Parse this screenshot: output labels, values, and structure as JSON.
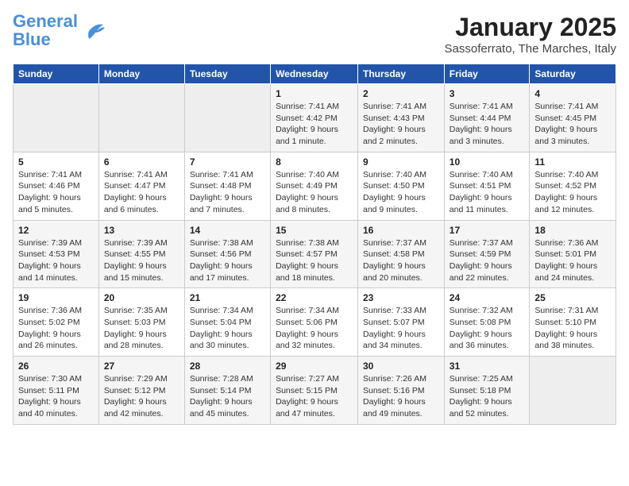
{
  "header": {
    "logo_line1": "General",
    "logo_line2": "Blue",
    "month": "January 2025",
    "location": "Sassoferrato, The Marches, Italy"
  },
  "weekdays": [
    "Sunday",
    "Monday",
    "Tuesday",
    "Wednesday",
    "Thursday",
    "Friday",
    "Saturday"
  ],
  "weeks": [
    [
      {
        "day": "",
        "info": ""
      },
      {
        "day": "",
        "info": ""
      },
      {
        "day": "",
        "info": ""
      },
      {
        "day": "1",
        "info": "Sunrise: 7:41 AM\nSunset: 4:42 PM\nDaylight: 9 hours and 1 minute."
      },
      {
        "day": "2",
        "info": "Sunrise: 7:41 AM\nSunset: 4:43 PM\nDaylight: 9 hours and 2 minutes."
      },
      {
        "day": "3",
        "info": "Sunrise: 7:41 AM\nSunset: 4:44 PM\nDaylight: 9 hours and 3 minutes."
      },
      {
        "day": "4",
        "info": "Sunrise: 7:41 AM\nSunset: 4:45 PM\nDaylight: 9 hours and 3 minutes."
      }
    ],
    [
      {
        "day": "5",
        "info": "Sunrise: 7:41 AM\nSunset: 4:46 PM\nDaylight: 9 hours and 5 minutes."
      },
      {
        "day": "6",
        "info": "Sunrise: 7:41 AM\nSunset: 4:47 PM\nDaylight: 9 hours and 6 minutes."
      },
      {
        "day": "7",
        "info": "Sunrise: 7:41 AM\nSunset: 4:48 PM\nDaylight: 9 hours and 7 minutes."
      },
      {
        "day": "8",
        "info": "Sunrise: 7:40 AM\nSunset: 4:49 PM\nDaylight: 9 hours and 8 minutes."
      },
      {
        "day": "9",
        "info": "Sunrise: 7:40 AM\nSunset: 4:50 PM\nDaylight: 9 hours and 9 minutes."
      },
      {
        "day": "10",
        "info": "Sunrise: 7:40 AM\nSunset: 4:51 PM\nDaylight: 9 hours and 11 minutes."
      },
      {
        "day": "11",
        "info": "Sunrise: 7:40 AM\nSunset: 4:52 PM\nDaylight: 9 hours and 12 minutes."
      }
    ],
    [
      {
        "day": "12",
        "info": "Sunrise: 7:39 AM\nSunset: 4:53 PM\nDaylight: 9 hours and 14 minutes."
      },
      {
        "day": "13",
        "info": "Sunrise: 7:39 AM\nSunset: 4:55 PM\nDaylight: 9 hours and 15 minutes."
      },
      {
        "day": "14",
        "info": "Sunrise: 7:38 AM\nSunset: 4:56 PM\nDaylight: 9 hours and 17 minutes."
      },
      {
        "day": "15",
        "info": "Sunrise: 7:38 AM\nSunset: 4:57 PM\nDaylight: 9 hours and 18 minutes."
      },
      {
        "day": "16",
        "info": "Sunrise: 7:37 AM\nSunset: 4:58 PM\nDaylight: 9 hours and 20 minutes."
      },
      {
        "day": "17",
        "info": "Sunrise: 7:37 AM\nSunset: 4:59 PM\nDaylight: 9 hours and 22 minutes."
      },
      {
        "day": "18",
        "info": "Sunrise: 7:36 AM\nSunset: 5:01 PM\nDaylight: 9 hours and 24 minutes."
      }
    ],
    [
      {
        "day": "19",
        "info": "Sunrise: 7:36 AM\nSunset: 5:02 PM\nDaylight: 9 hours and 26 minutes."
      },
      {
        "day": "20",
        "info": "Sunrise: 7:35 AM\nSunset: 5:03 PM\nDaylight: 9 hours and 28 minutes."
      },
      {
        "day": "21",
        "info": "Sunrise: 7:34 AM\nSunset: 5:04 PM\nDaylight: 9 hours and 30 minutes."
      },
      {
        "day": "22",
        "info": "Sunrise: 7:34 AM\nSunset: 5:06 PM\nDaylight: 9 hours and 32 minutes."
      },
      {
        "day": "23",
        "info": "Sunrise: 7:33 AM\nSunset: 5:07 PM\nDaylight: 9 hours and 34 minutes."
      },
      {
        "day": "24",
        "info": "Sunrise: 7:32 AM\nSunset: 5:08 PM\nDaylight: 9 hours and 36 minutes."
      },
      {
        "day": "25",
        "info": "Sunrise: 7:31 AM\nSunset: 5:10 PM\nDaylight: 9 hours and 38 minutes."
      }
    ],
    [
      {
        "day": "26",
        "info": "Sunrise: 7:30 AM\nSunset: 5:11 PM\nDaylight: 9 hours and 40 minutes."
      },
      {
        "day": "27",
        "info": "Sunrise: 7:29 AM\nSunset: 5:12 PM\nDaylight: 9 hours and 42 minutes."
      },
      {
        "day": "28",
        "info": "Sunrise: 7:28 AM\nSunset: 5:14 PM\nDaylight: 9 hours and 45 minutes."
      },
      {
        "day": "29",
        "info": "Sunrise: 7:27 AM\nSunset: 5:15 PM\nDaylight: 9 hours and 47 minutes."
      },
      {
        "day": "30",
        "info": "Sunrise: 7:26 AM\nSunset: 5:16 PM\nDaylight: 9 hours and 49 minutes."
      },
      {
        "day": "31",
        "info": "Sunrise: 7:25 AM\nSunset: 5:18 PM\nDaylight: 9 hours and 52 minutes."
      },
      {
        "day": "",
        "info": ""
      }
    ]
  ]
}
